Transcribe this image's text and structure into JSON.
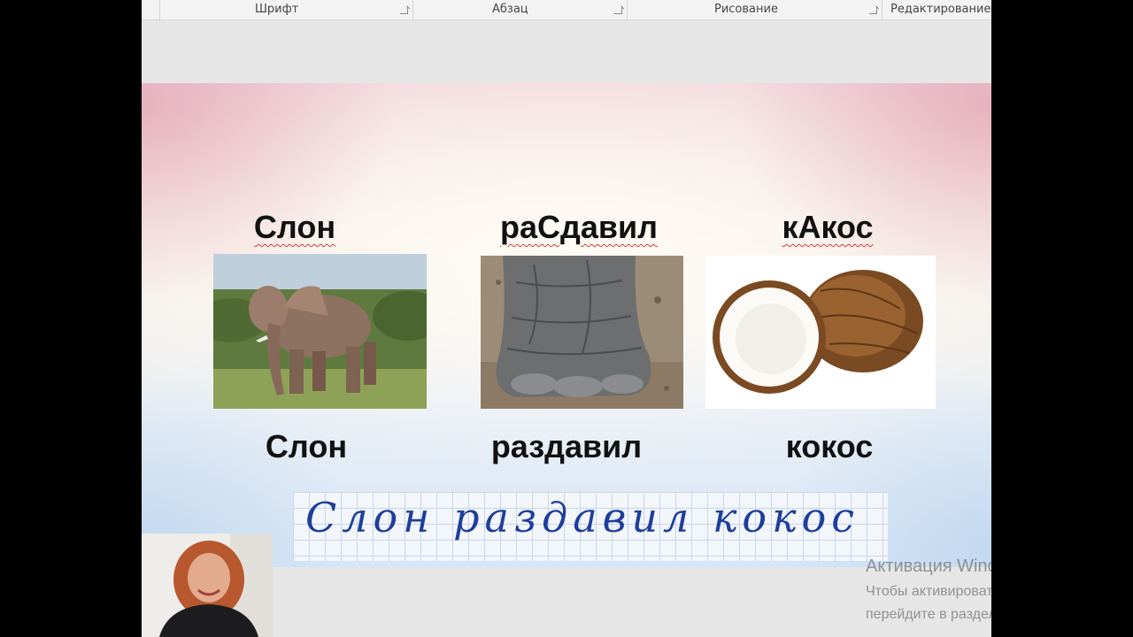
{
  "ribbon": {
    "groups": [
      {
        "label": "Шрифт"
      },
      {
        "label": "Абзац"
      },
      {
        "label": "Рисование"
      },
      {
        "label": "Редактирование"
      }
    ]
  },
  "slide": {
    "top_words": [
      "Слон",
      "раСдавил",
      "кАкос"
    ],
    "bottom_words": [
      "Слон",
      "раздавил",
      "кокос"
    ],
    "images": [
      {
        "icon": "elephant-photo"
      },
      {
        "icon": "elephant-foot-photo"
      },
      {
        "icon": "coconut-photo"
      }
    ],
    "handwriting": "Слон раздавил кокос"
  },
  "webcam": {
    "icon": "presenter-webcam"
  },
  "watermark": {
    "title": "Активация Windows",
    "line1": "Чтобы активировать Windows,",
    "line2": "перейдите в раздел \"Параметры\"."
  },
  "colors": {
    "spellcheck_underline": "#d23b3b",
    "handwriting_ink": "#1e3f9a",
    "grid_line": "#c8d6ec"
  }
}
